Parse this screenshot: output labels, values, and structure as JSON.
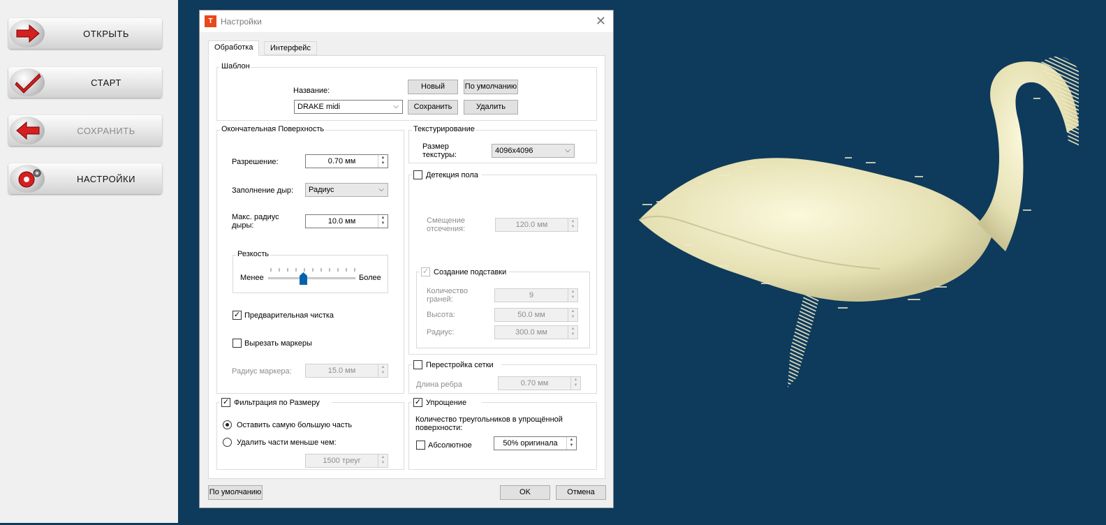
{
  "sidebar": {
    "open_label": "ОТКРЫТЬ",
    "start_label": "СТАРТ",
    "save_label": "СОХРАНИТЬ",
    "settings_label": "НАСТРОЙКИ"
  },
  "dialog": {
    "title": "Настройки",
    "tabs": [
      "Обработка",
      "Интерфейс"
    ],
    "template": {
      "group_label": "Шаблон",
      "name_label": "Название:",
      "name_value": "DRAKE midi",
      "new_button": "Новый",
      "default_button": "По умолчанию",
      "save_button": "Сохранить",
      "delete_button": "Удалить"
    },
    "final_surface": {
      "group_label": "Окончательная Поверхность",
      "resolution_label": "Разрешение:",
      "resolution_value": "0.70 мм",
      "hole_fill_label": "Заполнение дыр:",
      "hole_fill_value": "Радиус",
      "max_hole_radius_label": "Макс. радиус дыры:",
      "max_hole_radius_value": "10.0 мм",
      "sharpness_label": "Резкость",
      "sharpness_less": "Менее",
      "sharpness_more": "Более",
      "sharpness_level": 0.4,
      "pre_clean_label": "Предварительная чистка",
      "pre_clean_checked": true,
      "cut_markers_label": "Вырезать маркеры",
      "cut_markers_checked": false,
      "marker_radius_label": "Радиус маркера:",
      "marker_radius_value": "15.0 мм"
    },
    "size_filter": {
      "label": "Фильтрация по Размеру",
      "checked": true,
      "keep_largest_label": "Оставить самую большую часть",
      "remove_smaller_label": "Удалить части меньше чем:",
      "selected": "keep_largest",
      "threshold_value": "1500 треуг"
    },
    "texturing": {
      "group_label": "Текстурирование",
      "texture_size_label": "Размер текстуры:",
      "texture_size_value": "4096x4096"
    },
    "floor_detection": {
      "label": "Детекция пола",
      "checked": false,
      "clip_offset_label": "Смещение отсечения:",
      "clip_offset_value": "120.0 мм",
      "create_base_label": "Создание подставки",
      "create_base_checked": true,
      "faces_count_label": "Количество граней:",
      "faces_count_value": "9",
      "height_label": "Высота:",
      "height_value": "50.0 мм",
      "radius_label": "Радиус:",
      "radius_value": "300.0 мм"
    },
    "remesh": {
      "label": "Перестройка сетки",
      "checked": false,
      "edge_length_label": "Длина ребра",
      "edge_length_value": "0.70 мм"
    },
    "simplification": {
      "label": "Упрощение",
      "checked": true,
      "triangles_label": "Количество треугольников в упрощённой поверхности:",
      "absolute_label": "Абсолютное",
      "absolute_checked": false,
      "percent_value": "50% оригинала"
    },
    "footer": {
      "default_button": "По умолчанию",
      "ok_button": "OK",
      "cancel_button": "Отмена"
    }
  },
  "colors": {
    "viewport_bg": "#0e3a5b",
    "model_color": "#eeeac4",
    "accent_red": "#d42020",
    "slider_thumb": "#0063b1"
  },
  "icons": {
    "open": "arrow-right-icon",
    "start": "checkmark-icon",
    "save": "arrow-left-icon",
    "settings": "gear-icon",
    "close": "close-icon"
  }
}
